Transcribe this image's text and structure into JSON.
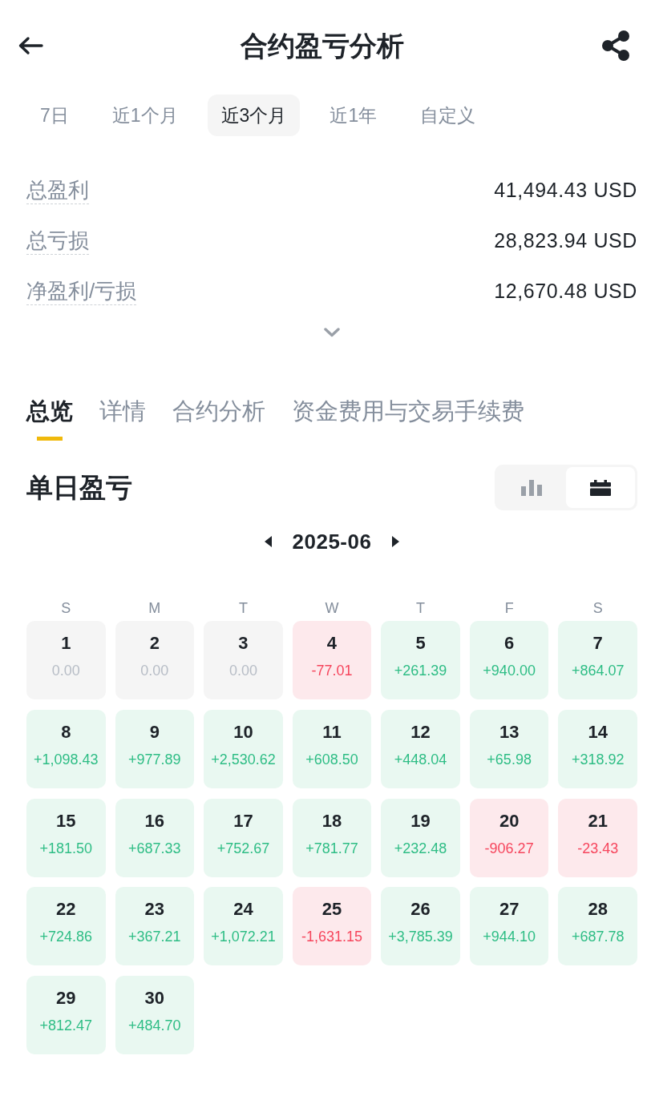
{
  "header": {
    "title": "合约盈亏分析"
  },
  "periods": [
    {
      "label": "7日",
      "selected": false
    },
    {
      "label": "近1个月",
      "selected": false
    },
    {
      "label": "近3个月",
      "selected": true
    },
    {
      "label": "近1年",
      "selected": false
    },
    {
      "label": "自定义",
      "selected": false
    }
  ],
  "summary": [
    {
      "label": "总盈利",
      "value": "41,494.43 USD"
    },
    {
      "label": "总亏损",
      "value": "28,823.94 USD"
    },
    {
      "label": "净盈利/亏损",
      "value": "12,670.48 USD"
    }
  ],
  "sections": [
    {
      "label": "总览",
      "selected": true
    },
    {
      "label": "详情",
      "selected": false
    },
    {
      "label": "合约分析",
      "selected": false
    },
    {
      "label": "资金费用与交易手续费",
      "selected": false
    }
  ],
  "daily_pnl": {
    "title": "单日盈亏",
    "view_toggle": [
      {
        "kind": "bar",
        "selected": false
      },
      {
        "kind": "calendar",
        "selected": true
      }
    ],
    "month": "2025-06",
    "weekdays": [
      "S",
      "M",
      "T",
      "W",
      "T",
      "F",
      "S"
    ],
    "days": [
      {
        "day": "1",
        "pnl": "0.00",
        "kind": "zero"
      },
      {
        "day": "2",
        "pnl": "0.00",
        "kind": "zero"
      },
      {
        "day": "3",
        "pnl": "0.00",
        "kind": "zero"
      },
      {
        "day": "4",
        "pnl": "-77.01",
        "kind": "loss"
      },
      {
        "day": "5",
        "pnl": "+261.39",
        "kind": "profit"
      },
      {
        "day": "6",
        "pnl": "+940.00",
        "kind": "profit"
      },
      {
        "day": "7",
        "pnl": "+864.07",
        "kind": "profit"
      },
      {
        "day": "8",
        "pnl": "+1,098.43",
        "kind": "profit"
      },
      {
        "day": "9",
        "pnl": "+977.89",
        "kind": "profit"
      },
      {
        "day": "10",
        "pnl": "+2,530.62",
        "kind": "profit"
      },
      {
        "day": "11",
        "pnl": "+608.50",
        "kind": "profit"
      },
      {
        "day": "12",
        "pnl": "+448.04",
        "kind": "profit"
      },
      {
        "day": "13",
        "pnl": "+65.98",
        "kind": "profit"
      },
      {
        "day": "14",
        "pnl": "+318.92",
        "kind": "profit"
      },
      {
        "day": "15",
        "pnl": "+181.50",
        "kind": "profit"
      },
      {
        "day": "16",
        "pnl": "+687.33",
        "kind": "profit"
      },
      {
        "day": "17",
        "pnl": "+752.67",
        "kind": "profit"
      },
      {
        "day": "18",
        "pnl": "+781.77",
        "kind": "profit"
      },
      {
        "day": "19",
        "pnl": "+232.48",
        "kind": "profit"
      },
      {
        "day": "20",
        "pnl": "-906.27",
        "kind": "loss"
      },
      {
        "day": "21",
        "pnl": "-23.43",
        "kind": "loss"
      },
      {
        "day": "22",
        "pnl": "+724.86",
        "kind": "profit"
      },
      {
        "day": "23",
        "pnl": "+367.21",
        "kind": "profit"
      },
      {
        "day": "24",
        "pnl": "+1,072.21",
        "kind": "profit"
      },
      {
        "day": "25",
        "pnl": "-1,631.15",
        "kind": "loss"
      },
      {
        "day": "26",
        "pnl": "+3,785.39",
        "kind": "profit"
      },
      {
        "day": "27",
        "pnl": "+944.10",
        "kind": "profit"
      },
      {
        "day": "28",
        "pnl": "+687.78",
        "kind": "profit"
      },
      {
        "day": "29",
        "pnl": "+812.47",
        "kind": "profit"
      },
      {
        "day": "30",
        "pnl": "+484.70",
        "kind": "profit"
      }
    ]
  }
}
